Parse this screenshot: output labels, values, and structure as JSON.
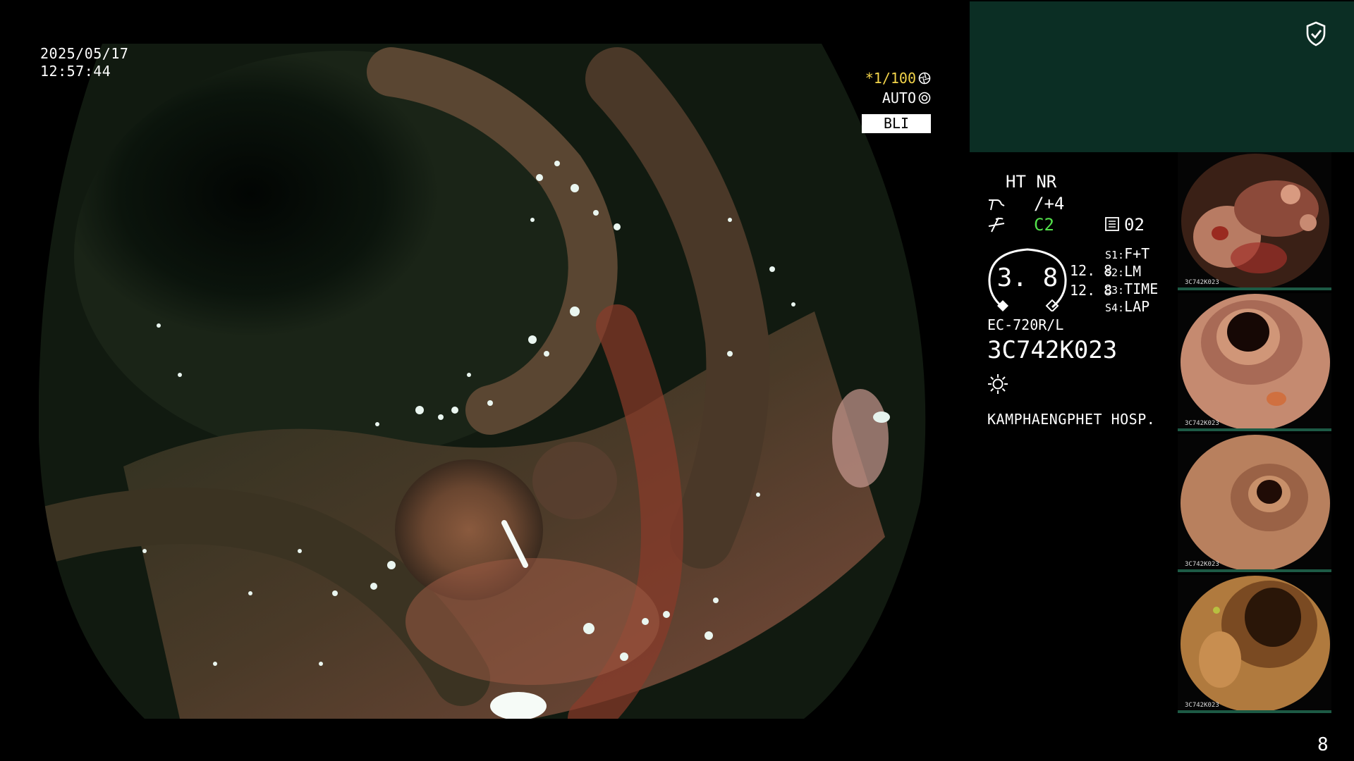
{
  "overlay": {
    "date": "2025/05/17",
    "time": "12:57:44",
    "shutter": "*1/100",
    "exposure_mode": "AUTO",
    "mode_badge": "BLI"
  },
  "info_panel": {
    "ht_nr": "HT NR",
    "enhancement_value": "/+4",
    "color_mode": "C2",
    "iris_value": "02",
    "gauge_value": "3. 8",
    "value_a": "12. 8",
    "value_b": "12. 8",
    "switches": [
      {
        "key": "S1:",
        "value": "F+T"
      },
      {
        "key": "S2:",
        "value": "LM"
      },
      {
        "key": "S3:",
        "value": "TIME"
      },
      {
        "key": "S4:",
        "value": "LAP"
      }
    ],
    "scope_model": "EC-720R/L",
    "scope_serial": "3C742K023",
    "hospital": "KAMPHAENGPHET HOSP."
  },
  "thumbnails": [
    {
      "label": "3C742K023"
    },
    {
      "label": "3C742K023"
    },
    {
      "label": "3C742K023"
    },
    {
      "label": "3C742K023"
    }
  ],
  "page_number": "8",
  "icons": {
    "shield": "shield-check-icon",
    "shutter": "aperture-icon",
    "auto": "auto-exposure-icon",
    "enhancement": "enhancement-icon",
    "color": "color-mode-icon",
    "iris": "iris-icon",
    "light": "light-source-icon"
  },
  "colors": {
    "panel": "#0b2e24",
    "shutter_value": "#f3d44a",
    "color_mode": "#54e24c"
  }
}
